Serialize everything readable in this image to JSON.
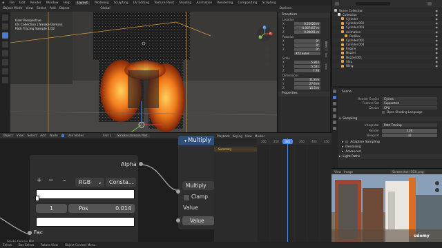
{
  "topbar": {
    "menus": [
      "File",
      "Edit",
      "Render",
      "Window",
      "Help"
    ],
    "workspaces": [
      "Layout",
      "Modeling",
      "Sculpting",
      "UV Editing",
      "Texture Paint",
      "Shading",
      "Animation",
      "Rendering",
      "Compositing",
      "Scripting"
    ],
    "scene": "Scene",
    "view_layer": "View Layer"
  },
  "viewport": {
    "mode": "Object Mode",
    "menus": [
      "View",
      "Select",
      "Add",
      "Object"
    ],
    "orientation": "Global",
    "options": "Options",
    "overlay_lines": [
      "User Perspective",
      "(0) Collection | Smoke Domain",
      "Path Tracing Sample 1/32"
    ],
    "gizmo_axes": [
      "X",
      "Y",
      "Z"
    ]
  },
  "npanel": {
    "section_transform": "Transform",
    "location_label": "Location",
    "location": [
      "0.22026 m",
      "-0.007457 m",
      "0.89691 m"
    ],
    "rotation_label": "Rotation",
    "rotation": [
      "0°",
      "0°",
      "0°"
    ],
    "rotation_mode": "XYZ Euler",
    "scale_label": "Scale",
    "scale": [
      "5.852",
      "5.521",
      "7.76"
    ],
    "dimensions_label": "Dimensions",
    "dimensions": [
      "11.8 m",
      "27.6 m",
      "15.3 m"
    ],
    "axis_labels": [
      "X",
      "Y",
      "Z"
    ],
    "section_properties": "Properties",
    "tabs": [
      "Item",
      "Tool",
      "View"
    ]
  },
  "outliner": {
    "items": [
      {
        "name": "Scene Collection",
        "color": "#bbbbbb"
      },
      {
        "name": "Collection",
        "color": "#dddddd"
      },
      {
        "name": "Cylinder",
        "color": "#e8a24a"
      },
      {
        "name": "Cylinder.002",
        "color": "#e8a24a"
      },
      {
        "name": "Cylinder.003",
        "color": "#e8a24a"
      },
      {
        "name": "Animation",
        "color": "#e8a24a"
      },
      {
        "name": "RedBox",
        "color": "#e8a24a"
      },
      {
        "name": "Cylinder.001",
        "color": "#e8a24a"
      },
      {
        "name": "Cylinder.004",
        "color": "#e8a24a"
      },
      {
        "name": "Engine",
        "color": "#e8a24a"
      },
      {
        "name": "Nozzel",
        "color": "#e8a24a"
      },
      {
        "name": "Nozzel.001",
        "color": "#e8a24a"
      },
      {
        "name": "Ship",
        "color": "#e8a24a"
      },
      {
        "name": "Wing",
        "color": "#e8a24a"
      }
    ]
  },
  "properties": {
    "scene_name": "Scene",
    "rows": [
      {
        "label": "Render Engine",
        "value": "Cycles"
      },
      {
        "label": "Feature Set",
        "value": "Supported"
      },
      {
        "label": "Device",
        "value": "CPU"
      }
    ],
    "osl_label": "Open Shading Language",
    "sampling_header": "Sampling",
    "integrator_label": "Integrator",
    "integrator_value": "Path Tracing",
    "render_label": "Render",
    "render_value": "128",
    "viewport_label": "Viewport",
    "viewport_value": "32",
    "adaptive": "Adaptive Sampling",
    "denoising": "Denoising",
    "advanced": "Advanced",
    "light_paths": "Light Paths"
  },
  "node_editor": {
    "menus": [
      "Object",
      "View",
      "Select",
      "Add",
      "Node",
      "Use Nodes"
    ],
    "slot": "Slot 1",
    "material": "Smoke Domain Mat",
    "colorramp": {
      "alpha_label": "Alpha",
      "add": "+",
      "remove": "−",
      "menu": "⌄",
      "color_mode": "RGB",
      "interpolation": "Consta...",
      "stop_index": "1",
      "pos_label": "Pos",
      "pos_value": "0.014",
      "fac_label": "Fac"
    },
    "math_node": {
      "title": "Multiply",
      "operation": "Multiply",
      "clamp_label": "Clamp",
      "value_out": "Value",
      "value_field": "Value"
    },
    "footer": "Smoke Domain Mat"
  },
  "dopesheet": {
    "menus": [
      "Playback",
      "Keying",
      "View",
      "Marker"
    ],
    "summary": "Summary",
    "ticks": [
      "200",
      "250",
      "300",
      "350",
      "400",
      "450"
    ],
    "current_frame": "381"
  },
  "image_editor": {
    "menus": [
      "View",
      "Image"
    ],
    "image_name": "Screenshot (353).png"
  },
  "status": {
    "items": [
      "Select",
      "Box Select",
      "Rotate View",
      "Object Context Menu"
    ]
  },
  "watermark": "udemy"
}
